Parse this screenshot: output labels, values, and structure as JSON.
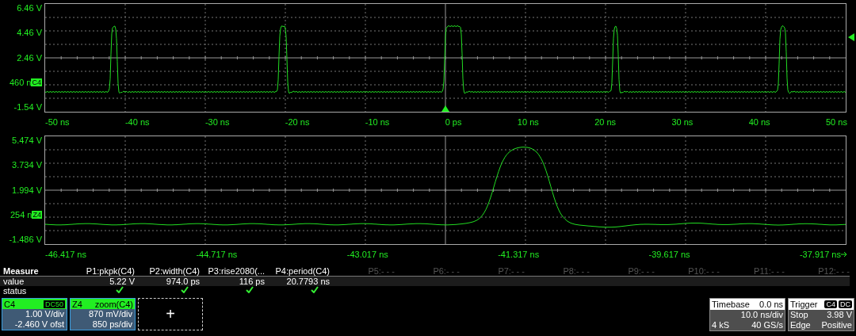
{
  "plots": [
    {
      "kind": "main",
      "y_labels": [
        {
          "text": "6.46 V"
        },
        {
          "text": "4.46 V"
        },
        {
          "text": "2.46 V"
        },
        {
          "text": "460 n",
          "badge": "C4"
        },
        {
          "text": "-1.54 V"
        }
      ],
      "x_labels": [
        "-50 ns",
        "-40 ns",
        "-30 ns",
        "-20 ns",
        "-10 ns",
        "0 ps",
        "10 ns",
        "20 ns",
        "30 ns",
        "40 ns",
        "50 ns"
      ]
    },
    {
      "kind": "zoom",
      "y_labels": [
        {
          "text": "5.474 V"
        },
        {
          "text": "3.734 V"
        },
        {
          "text": "1.994 V"
        },
        {
          "text": "254 n",
          "badge": "Z4"
        },
        {
          "text": "-1.486 V"
        }
      ],
      "x_labels": [
        "-46.417 ns",
        "-44.717 ns",
        "-43.017 ns",
        "-41.317 ns",
        "-39.617 ns",
        "-37.917 ns"
      ]
    }
  ],
  "measure": {
    "title": "Measure",
    "row_labels": [
      "value",
      "status"
    ],
    "params": [
      {
        "name": "P1:pkpk(C4)",
        "value": "5.22 V",
        "status_ok": true,
        "disabled": false
      },
      {
        "name": "P2:width(C4)",
        "value": "974.0 ps",
        "status_ok": true,
        "disabled": false
      },
      {
        "name": "P3:rise2080(...",
        "value": "116 ps",
        "status_ok": true,
        "disabled": false
      },
      {
        "name": "P4:period(C4)",
        "value": "20.7793 ns",
        "status_ok": true,
        "disabled": false
      },
      {
        "name": "P5:- - -",
        "disabled": true
      },
      {
        "name": "P6:- - -",
        "disabled": true
      },
      {
        "name": "P7:- - -",
        "disabled": true
      },
      {
        "name": "P8:- - -",
        "disabled": true
      },
      {
        "name": "P9:- - -",
        "disabled": true
      },
      {
        "name": "P10:- - -",
        "disabled": true
      },
      {
        "name": "P11:- - -",
        "disabled": true
      },
      {
        "name": "P12:- - -",
        "disabled": true
      }
    ]
  },
  "channels": [
    {
      "name": "C4",
      "tag": "DC50",
      "lines": [
        "1.00 V/div",
        "-2.460 V ofst"
      ]
    },
    {
      "name": "Z4",
      "source": "zoom(C4)",
      "lines": [
        "870 mV/div",
        "850 ps/div"
      ]
    }
  ],
  "add_button": "+",
  "timebase": {
    "title": "Timebase",
    "delay": "0.0 ns",
    "scale": "10.0 ns/div",
    "samples": "4 kS",
    "rate": "40 GS/s"
  },
  "trigger": {
    "title": "Trigger",
    "source": "C4",
    "coupling": "DC",
    "mode": "Stop",
    "threshold": "3.98 V",
    "type": "Edge",
    "slope": "Positive"
  }
}
